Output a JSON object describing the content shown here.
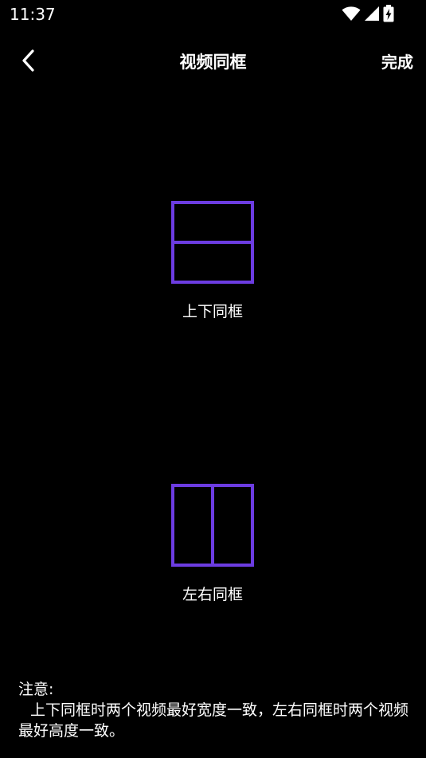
{
  "status_bar": {
    "time": "11:37",
    "icons": [
      "wifi-icon",
      "signal-icon",
      "battery-charging-icon"
    ]
  },
  "header": {
    "back_icon": "chevron-left-icon",
    "title": "视频同框",
    "done_label": "完成"
  },
  "options": [
    {
      "icon": "split-top-bottom-icon",
      "label": "上下同框"
    },
    {
      "icon": "split-left-right-icon",
      "label": "左右同框"
    }
  ],
  "note": {
    "title": "注意:",
    "body": "上下同框时两个视频最好宽度一致，左右同框时两个视频最好高度一致。"
  },
  "colors": {
    "background": "#000000",
    "text": "#ffffff",
    "accent": "#6c3ce1"
  }
}
